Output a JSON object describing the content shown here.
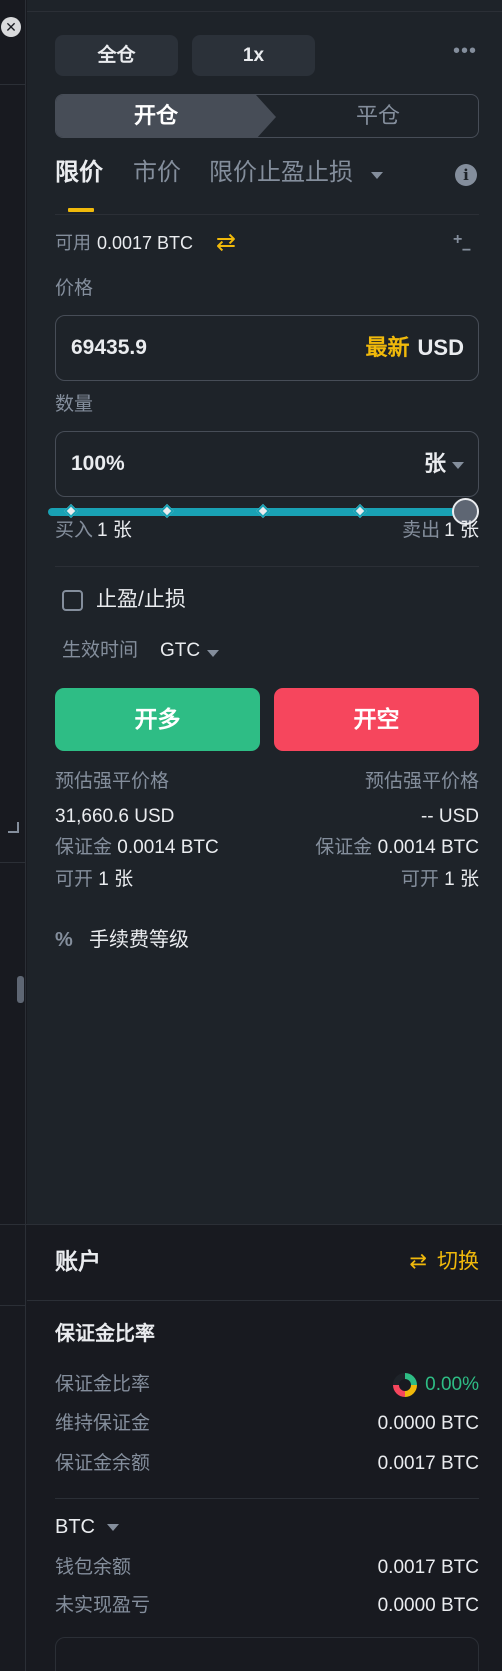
{
  "header": {
    "margin_mode": "全仓",
    "leverage": "1x",
    "more_icon": "more-dots-icon"
  },
  "open_close": {
    "open": "开仓",
    "close": "平仓"
  },
  "order_types": {
    "limit": "限价",
    "market": "市价",
    "tpsl": "限价止盈止损"
  },
  "available": {
    "label": "可用",
    "value": "0.0017 BTC"
  },
  "price": {
    "label": "价格",
    "value": "69435.9",
    "latest": "最新",
    "unit": "USD"
  },
  "quantity": {
    "label": "数量",
    "value": "100%",
    "unit": "张",
    "slider_fraction": 1.0
  },
  "slider_labels": {
    "buy_label": "买入",
    "buy_value": "1 张",
    "sell_label": "卖出",
    "sell_value": "1 张"
  },
  "tpsl": {
    "label": "止盈/止损",
    "checked": false
  },
  "time_in_force": {
    "label": "生效时间",
    "value": "GTC"
  },
  "buttons": {
    "long": "开多",
    "short": "开空"
  },
  "long_info": {
    "liq_label": "预估强平价格",
    "liq_value": "31,660.6 USD",
    "margin_label": "保证金",
    "margin_value": "0.0014 BTC",
    "max_open_label": "可开",
    "max_open_value": "1 张"
  },
  "short_info": {
    "liq_label": "预估强平价格",
    "liq_value": "-- USD",
    "margin_label": "保证金",
    "margin_value": "0.0014 BTC",
    "max_open_label": "可开",
    "max_open_value": "1 张"
  },
  "fee_level": "手续费等级",
  "account": {
    "title": "账户",
    "switch": "切换",
    "margin_ratio_title": "保证金比率",
    "rows": [
      {
        "label": "保证金比率",
        "value": "0.00%"
      },
      {
        "label": "维持保证金",
        "value": "0.0000 BTC"
      },
      {
        "label": "保证金余额",
        "value": "0.0017 BTC"
      }
    ],
    "asset_selector": "BTC",
    "asset_rows": [
      {
        "label": "钱包余额",
        "value": "0.0017 BTC"
      },
      {
        "label": "未实现盈亏",
        "value": "0.0000 BTC"
      }
    ]
  },
  "colors": {
    "accent": "#f0b90b",
    "buy": "#2ebd85",
    "sell": "#f6465d",
    "slider": "#19a1b4",
    "background": "#1e2329"
  }
}
